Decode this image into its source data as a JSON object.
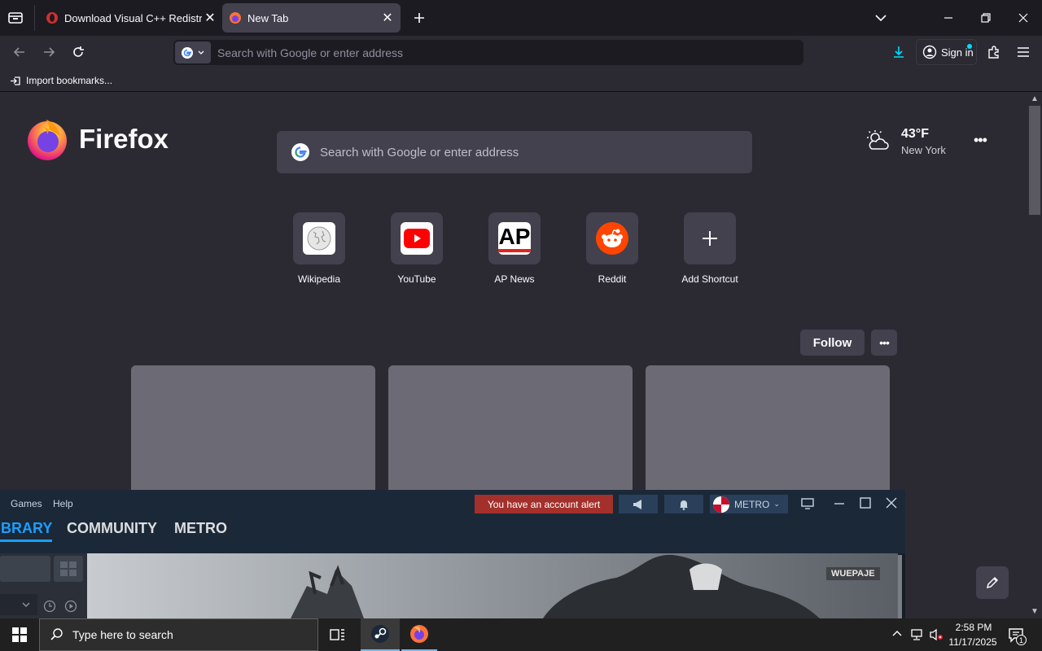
{
  "browser": {
    "tabs": [
      {
        "title": "Download Visual C++ Redistributable",
        "active": false
      },
      {
        "title": "New Tab",
        "active": true
      }
    ],
    "url_placeholder": "Search with Google or enter address",
    "sign_in_label": "Sign in",
    "bookmarks": {
      "import_label": "Import bookmarks..."
    }
  },
  "newtab": {
    "brand": "Firefox",
    "search_placeholder": "Search with Google or enter address",
    "weather": {
      "temp": "43°F",
      "location": "New York"
    },
    "shortcuts": [
      {
        "label": "Wikipedia",
        "icon": "wikipedia-icon"
      },
      {
        "label": "YouTube",
        "icon": "youtube-icon"
      },
      {
        "label": "AP News",
        "icon": "apnews-icon"
      },
      {
        "label": "Reddit",
        "icon": "reddit-icon"
      },
      {
        "label": "Add Shortcut",
        "icon": "plus-icon"
      }
    ],
    "follow_label": "Follow",
    "ap_logo_text": "AP"
  },
  "steam": {
    "menu": [
      "Games",
      "Help"
    ],
    "alert": "You have an account alert",
    "username": "METRO",
    "nav": [
      "IBRARY",
      "COMMUNITY",
      "METRO"
    ],
    "art_badge": "WUEPAJE"
  },
  "taskbar": {
    "search_placeholder": "Type here to search",
    "time": "2:58 PM",
    "date": "11/17/2025",
    "notification_count": "1"
  },
  "colors": {
    "accent": "#00ddff",
    "steam_alert": "#a4302b",
    "steam_nav_active": "#1a9fff"
  }
}
